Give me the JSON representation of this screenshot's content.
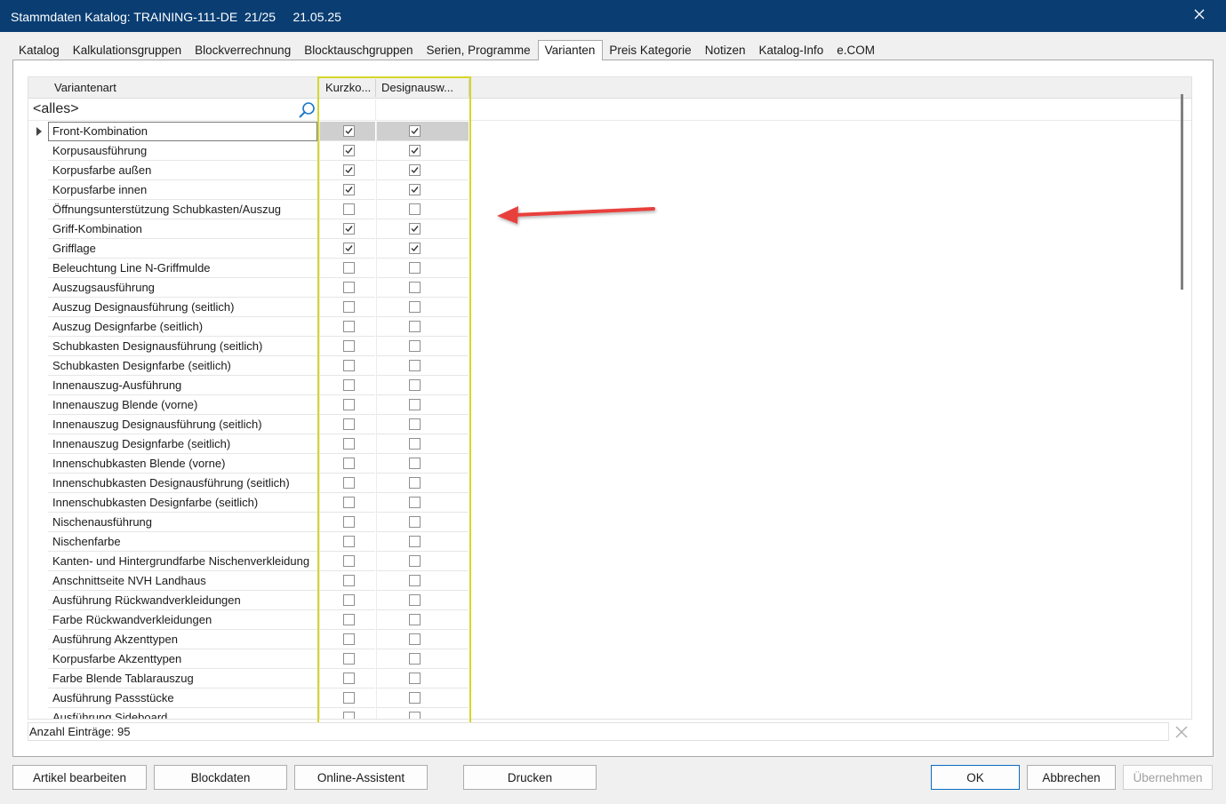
{
  "window": {
    "title": "Stammdaten Katalog: TRAINING-111-DE  21/25     21.05.25"
  },
  "tabs": [
    {
      "label": "Katalog"
    },
    {
      "label": "Kalkulationsgruppen"
    },
    {
      "label": "Blockverrechnung"
    },
    {
      "label": "Blocktauschgruppen"
    },
    {
      "label": "Serien, Programme"
    },
    {
      "label": "Varianten",
      "active": true
    },
    {
      "label": "Preis Kategorie"
    },
    {
      "label": "Notizen"
    },
    {
      "label": "Katalog-Info"
    },
    {
      "label": "e.COM"
    }
  ],
  "grid": {
    "columns": {
      "name": "Variantenart",
      "short": "Kurzko...",
      "design": "Designausw..."
    },
    "filter_text": "<alles>",
    "rows": [
      {
        "label": "Front-Kombination",
        "short": true,
        "design": true,
        "selected": true
      },
      {
        "label": "Korpusausführung",
        "short": true,
        "design": true
      },
      {
        "label": "Korpusfarbe außen",
        "short": true,
        "design": true
      },
      {
        "label": "Korpusfarbe innen",
        "short": true,
        "design": true
      },
      {
        "label": "Öffnungsunterstützung Schubkasten/Auszug",
        "short": false,
        "design": false
      },
      {
        "label": "Griff-Kombination",
        "short": true,
        "design": true
      },
      {
        "label": "Grifflage",
        "short": true,
        "design": true
      },
      {
        "label": "Beleuchtung Line N-Griffmulde",
        "short": false,
        "design": false
      },
      {
        "label": "Auszugsausführung",
        "short": false,
        "design": false
      },
      {
        "label": "Auszug Designausführung (seitlich)",
        "short": false,
        "design": false
      },
      {
        "label": "Auszug Designfarbe (seitlich)",
        "short": false,
        "design": false
      },
      {
        "label": "Schubkasten Designausführung (seitlich)",
        "short": false,
        "design": false
      },
      {
        "label": "Schubkasten Designfarbe (seitlich)",
        "short": false,
        "design": false
      },
      {
        "label": "Innenauszug-Ausführung",
        "short": false,
        "design": false
      },
      {
        "label": "Innenauszug Blende (vorne)",
        "short": false,
        "design": false
      },
      {
        "label": "Innenauszug Designausführung (seitlich)",
        "short": false,
        "design": false
      },
      {
        "label": "Innenauszug Designfarbe (seitlich)",
        "short": false,
        "design": false
      },
      {
        "label": "Innenschubkasten Blende (vorne)",
        "short": false,
        "design": false
      },
      {
        "label": "Innenschubkasten Designausführung (seitlich)",
        "short": false,
        "design": false
      },
      {
        "label": "Innenschubkasten Designfarbe (seitlich)",
        "short": false,
        "design": false
      },
      {
        "label": "Nischenausführung",
        "short": false,
        "design": false
      },
      {
        "label": "Nischenfarbe",
        "short": false,
        "design": false
      },
      {
        "label": "Kanten- und Hintergrundfarbe Nischenverkleidung",
        "short": false,
        "design": false
      },
      {
        "label": "Anschnittseite NVH Landhaus",
        "short": false,
        "design": false
      },
      {
        "label": "Ausführung Rückwandverkleidungen",
        "short": false,
        "design": false
      },
      {
        "label": "Farbe Rückwandverkleidungen",
        "short": false,
        "design": false
      },
      {
        "label": "Ausführung Akzenttypen",
        "short": false,
        "design": false
      },
      {
        "label": "Korpusfarbe Akzenttypen",
        "short": false,
        "design": false
      },
      {
        "label": "Farbe Blende Tablarauszug",
        "short": false,
        "design": false
      },
      {
        "label": "Ausführung Passstücke",
        "short": false,
        "design": false
      },
      {
        "label": "Ausführung Sideboard",
        "short": false,
        "design": false
      }
    ]
  },
  "status": {
    "count_text": "Anzahl Einträge: 95"
  },
  "buttons": {
    "edit_article": "Artikel bearbeiten",
    "block_data": "Blockdaten",
    "online_assistant": "Online-Assistent",
    "print": "Drucken",
    "ok": "OK",
    "cancel": "Abbrechen",
    "apply": "Übernehmen"
  },
  "colors": {
    "titlebar": "#0a3e73",
    "highlight_box": "#d4d72a",
    "annotation_arrow": "#e8413c"
  },
  "icons": {
    "close": "close-icon",
    "search": "search-icon",
    "clear_filter": "clear-filter-icon",
    "row_pointer": "row-pointer-icon"
  }
}
